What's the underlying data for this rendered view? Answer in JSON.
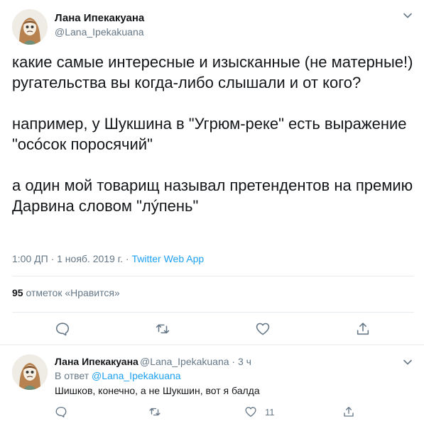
{
  "main_tweet": {
    "author_name": "Лана Ипекакуана",
    "author_handle": "@Lana_Ipekakuana",
    "paragraphs": [
      "какие самые интересные и изысканные (не матерные!) ругательства вы когда-либо слышали и от кого?",
      "например, у Шукшина в \"Угрюм-реке\" есть выражение \"осóсок поросячий\"",
      "а один мой товарищ называл претендентов на премию Дарвина словом \"лýпень\""
    ],
    "timestamp": "1:00 ДП · 1 нояб. 2019 г. · ",
    "source_app": "Twitter Web App",
    "likes_count": "95",
    "likes_label": " отметок «Нравится»"
  },
  "reply_tweet": {
    "author_name": "Лана Ипекакуана",
    "author_handle": "@Lana_Ipekakuana",
    "time": " · 3 ч",
    "reply_prefix": "В ответ ",
    "reply_to": "@Lana_Ipekakuana",
    "text": "Шишков, конечно, а не Шукшин, вот я балда",
    "like_count": "11"
  },
  "icons": [
    "chevron-down-icon",
    "reply-icon",
    "retweet-icon",
    "like-icon",
    "share-icon"
  ],
  "colors": {
    "text": "#14171a",
    "secondary": "#657786",
    "accent": "#1da1f2",
    "divider": "#e6ecf0"
  }
}
